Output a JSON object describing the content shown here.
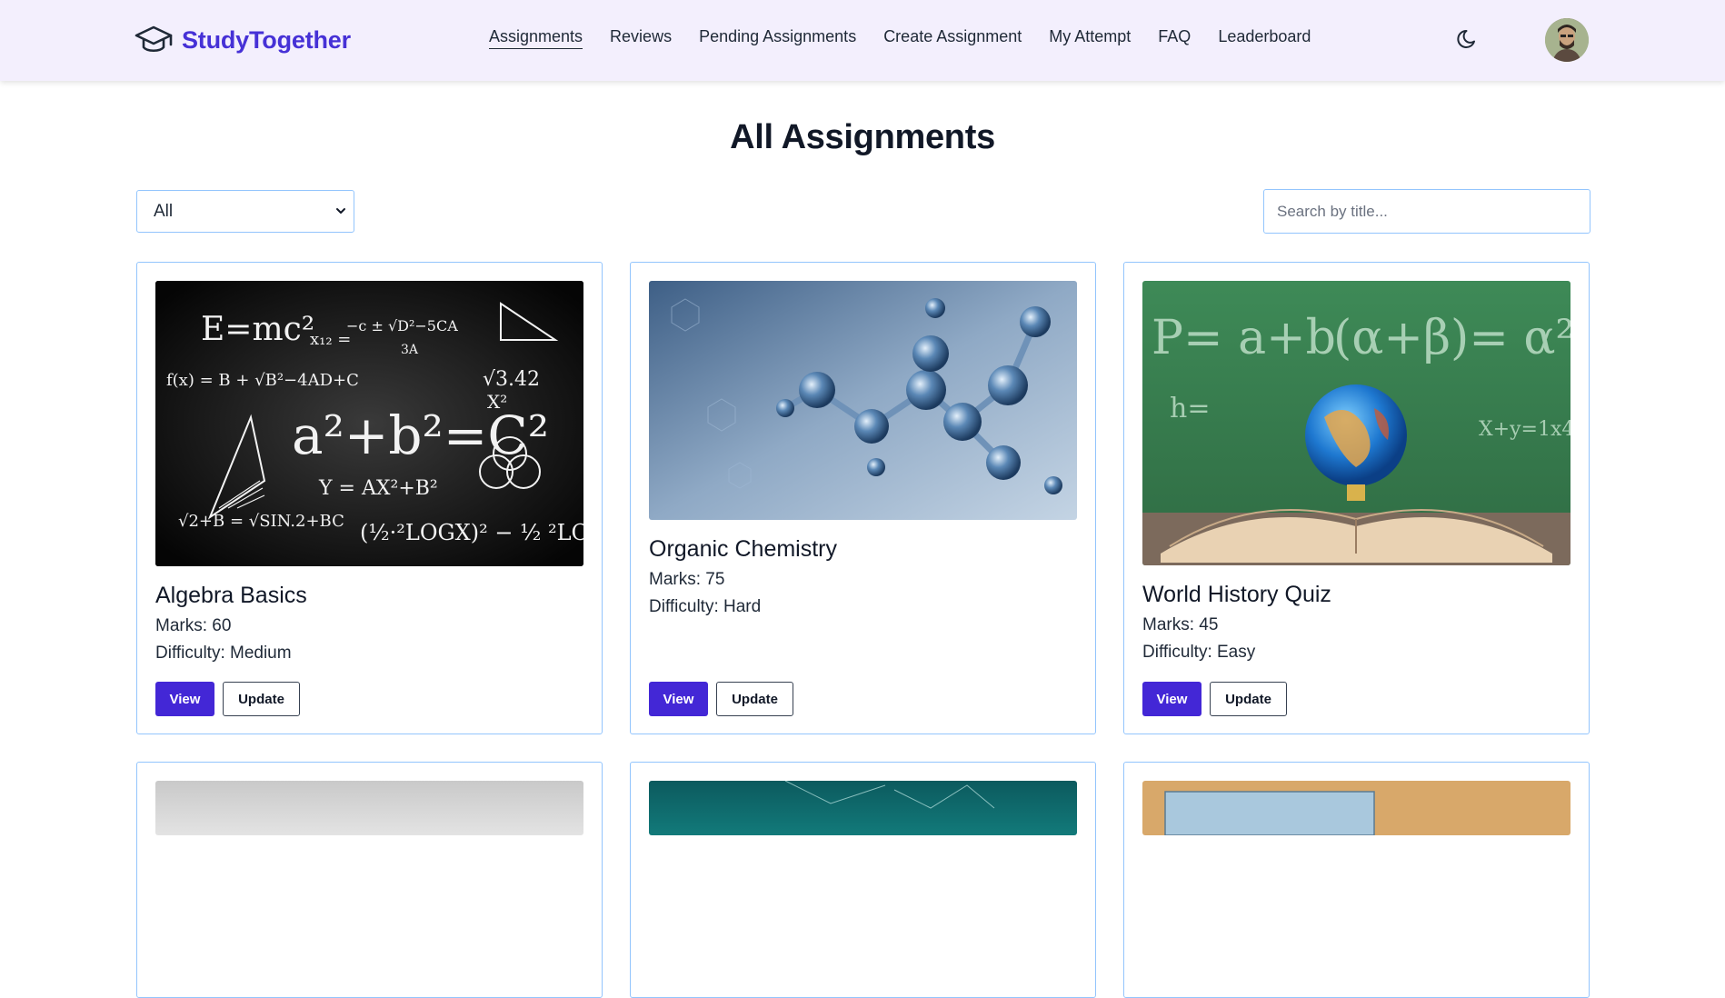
{
  "app": {
    "brand_name": "StudyTogether",
    "brand_icon": "graduation-cap-icon",
    "brand_color": "#4631d6",
    "navbar_bg": "#f3effd"
  },
  "nav": {
    "items": [
      {
        "label": "Assignments",
        "active": true
      },
      {
        "label": "Reviews",
        "active": false
      },
      {
        "label": "Pending Assignments",
        "active": false
      },
      {
        "label": "Create Assignment",
        "active": false
      },
      {
        "label": "My Attempt",
        "active": false
      },
      {
        "label": "FAQ",
        "active": false
      },
      {
        "label": "Leaderboard",
        "active": false
      }
    ],
    "theme_toggle_icon": "moon-icon"
  },
  "page": {
    "title": "All Assignments",
    "filter": {
      "selected": "All"
    },
    "search": {
      "placeholder": "Search by title...",
      "value": ""
    }
  },
  "cards": [
    {
      "title": "Algebra Basics",
      "marks": "Marks: 60",
      "difficulty": "Difficulty: Medium",
      "image": "math-chalkboard-image",
      "view_label": "View",
      "update_label": "Update"
    },
    {
      "title": "Organic Chemistry",
      "marks": "Marks: 75",
      "difficulty": "Difficulty: Hard",
      "image": "molecule-model-image",
      "view_label": "View",
      "update_label": "Update"
    },
    {
      "title": "World History Quiz",
      "marks": "Marks: 45",
      "difficulty": "Difficulty: Easy",
      "image": "globe-on-book-image",
      "view_label": "View",
      "update_label": "Update"
    }
  ],
  "colors": {
    "primary_button": "#4327d6",
    "card_border": "#93c5fd"
  }
}
